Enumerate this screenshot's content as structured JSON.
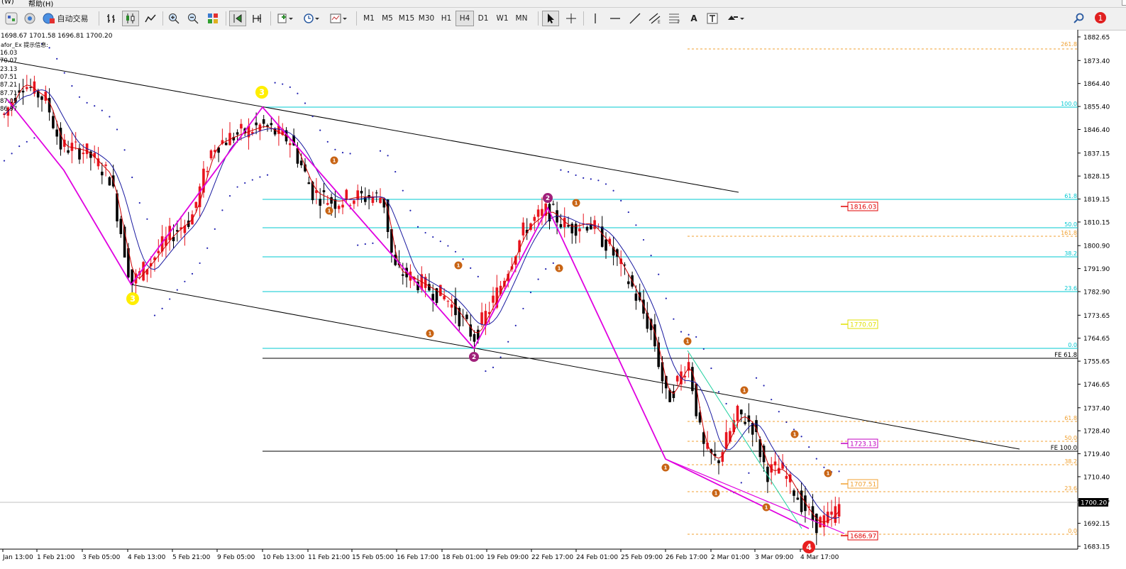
{
  "menu": {
    "item1": "(W)",
    "item2": "帮助(H)"
  },
  "toolbar": {
    "autotrade_label": "自动交易",
    "timeframes": [
      "M1",
      "M5",
      "M15",
      "M30",
      "H1",
      "H4",
      "D1",
      "W1",
      "MN"
    ],
    "active_timeframe": "H4",
    "text_tool_label": "A",
    "notification_count": "1"
  },
  "chart": {
    "ohlc_line": "1698.67 1701.58 1696.81 1700.20",
    "indicator_label": "afor_Ex 提示信息:",
    "left_values": [
      "16.03",
      "70.07",
      "23.13",
      "07.51",
      "87.21",
      "87.71",
      "87.05",
      "86.97"
    ],
    "price_axis": [
      "1882.65",
      "1873.40",
      "1864.40",
      "1855.40",
      "1846.40",
      "1837.15",
      "1828.15",
      "1819.15",
      "1810.15",
      "1800.90",
      "1791.90",
      "1782.90",
      "1773.65",
      "1764.65",
      "1755.65",
      "1746.65",
      "1737.40",
      "1728.40",
      "1719.40",
      "1710.40",
      "1701.15",
      "1692.15",
      "1683.15"
    ],
    "current_price": "1700.20",
    "time_axis": [
      "Jan 13:00",
      "1 Feb 21:00",
      "3 Feb 05:00",
      "4 Feb 13:00",
      "5 Feb 21:00",
      "9 Feb 05:00",
      "10 Feb 13:00",
      "11 Feb 21:00",
      "15 Feb 05:00",
      "16 Feb 17:00",
      "18 Feb 01:00",
      "19 Feb 09:00",
      "22 Feb 17:00",
      "24 Feb 01:00",
      "25 Feb 09:00",
      "26 Feb 17:00",
      "2 Mar 01:00",
      "3 Mar 09:00",
      "4 Mar 17:00"
    ],
    "fib_upper": [
      "261.8",
      "100.0",
      "61.8",
      "50.0",
      "38.2",
      "23.6",
      "0.0"
    ],
    "fib_lower": [
      "161.8",
      "100.0",
      "61.8",
      "50.0",
      "38.2",
      "23.6",
      "0.0"
    ],
    "fe_labels": [
      "FE 61.8",
      "FE 100.0"
    ],
    "price_tags": [
      "1816.03",
      "1770.07",
      "1723.13",
      "1707.51",
      "1686.97"
    ],
    "wave_labels": {
      "wave3": "3",
      "wave2": "2",
      "wave1": "1",
      "wave4": "4"
    },
    "colors": {
      "bull": "#e8141e",
      "bear": "#000000",
      "wave": "#e000e0",
      "fib_upper": "#00c8d2",
      "fib_lower": "#f0a030",
      "ma_fast": "#cc0000",
      "ma_slow": "#1a1aa0",
      "sar": "#2020b0",
      "wave3_badge": "#ffee00",
      "wave2_badge": "#a0207a",
      "wave1_badge": "#c86414",
      "wave4_badge": "#e81e1e"
    }
  }
}
